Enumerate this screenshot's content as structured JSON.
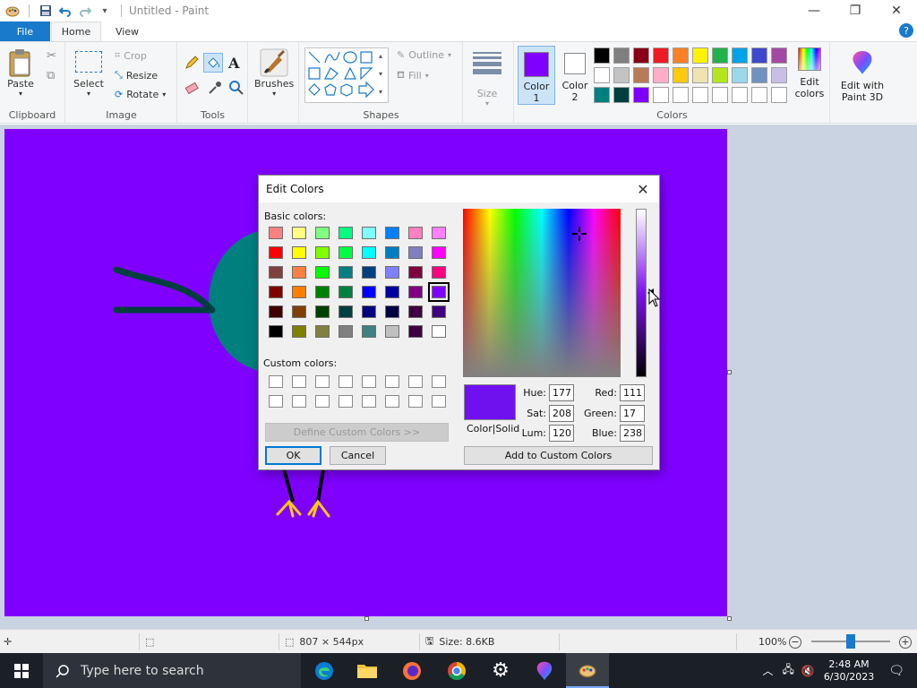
{
  "window": {
    "title": "Untitled - Paint",
    "controls": {
      "minimize": "—",
      "maximize": "❐",
      "close": "✕"
    }
  },
  "tabs": {
    "file": "File",
    "home": "Home",
    "view": "View"
  },
  "ribbon": {
    "clipboard": {
      "label": "Clipboard",
      "paste": "Paste"
    },
    "image": {
      "label": "Image",
      "select": "Select",
      "crop": "Crop",
      "resize": "Resize",
      "rotate": "Rotate"
    },
    "tools": {
      "label": "Tools"
    },
    "brushes": {
      "label": "Brushes"
    },
    "shapes": {
      "label": "Shapes",
      "outline": "Outline",
      "fill": "Fill"
    },
    "size": {
      "label": "Size"
    },
    "colors": {
      "label": "Colors",
      "color1": "Color 1",
      "color1_l1": "Color",
      "color1_l2": "1",
      "color2_l1": "Color",
      "color2_l2": "2",
      "color1_value": "#7f00ff",
      "color2_value": "#ffffff",
      "edit_colors_l1": "Edit",
      "edit_colors_l2": "colors",
      "paint3d_l1": "Edit with",
      "paint3d_l2": "Paint 3D",
      "palette_row1": [
        "#000000",
        "#7f7f7f",
        "#880015",
        "#ed1c24",
        "#ff7f27",
        "#fff200",
        "#22b14c",
        "#00a2e8",
        "#3f48cc",
        "#a349a4"
      ],
      "palette_row2": [
        "#ffffff",
        "#c3c3c3",
        "#b97a57",
        "#ffaec9",
        "#ffc90e",
        "#efe4b0",
        "#b5e61d",
        "#99d9ea",
        "#7092be",
        "#c8bfe7"
      ],
      "palette_row3": [
        "#007f7f",
        "#003f3f",
        "#7f00ff",
        "",
        "",
        "",
        "",
        "",
        "",
        ""
      ]
    }
  },
  "dialog": {
    "title": "Edit Colors",
    "basic_label": "Basic colors:",
    "custom_label": "Custom colors:",
    "basic_colors": [
      [
        "#ff8080",
        "#ffff80",
        "#80ff80",
        "#00ff80",
        "#80ffff",
        "#0080ff",
        "#ff80c0",
        "#ff80ff"
      ],
      [
        "#ff0000",
        "#ffff00",
        "#80ff00",
        "#00ff40",
        "#00ffff",
        "#0080c0",
        "#8080c0",
        "#ff00ff"
      ],
      [
        "#804040",
        "#ff8040",
        "#00ff00",
        "#008080",
        "#004080",
        "#8080ff",
        "#800040",
        "#ff0080"
      ],
      [
        "#800000",
        "#ff8000",
        "#008000",
        "#008040",
        "#0000ff",
        "#0000a0",
        "#800080",
        "#8000ff"
      ],
      [
        "#400000",
        "#804000",
        "#004000",
        "#004040",
        "#000080",
        "#000040",
        "#400040",
        "#400080"
      ],
      [
        "#000000",
        "#808000",
        "#808040",
        "#808080",
        "#408080",
        "#c0c0c0",
        "#400040",
        "#ffffff"
      ]
    ],
    "define_custom": "Define Custom Colors >>",
    "ok": "OK",
    "cancel": "Cancel",
    "preview_label": "Color|Solid",
    "preview_color": "#6f11ee",
    "hue_label": "Hue:",
    "hue": "177",
    "sat_label": "Sat:",
    "sat": "208",
    "lum_label": "Lum:",
    "lum": "120",
    "red_label": "Red:",
    "red": "111",
    "green_label": "Green:",
    "green": "17",
    "blue_label": "Blue:",
    "blue": "238",
    "add_custom": "Add to Custom Colors"
  },
  "status": {
    "dimensions": "807 × 544px",
    "size": "Size: 8.6KB",
    "zoom": "100%",
    "zoom_level": 0.5
  },
  "taskbar": {
    "search_placeholder": "Type here to search",
    "time": "2:48 AM",
    "date": "6/30/2023"
  }
}
